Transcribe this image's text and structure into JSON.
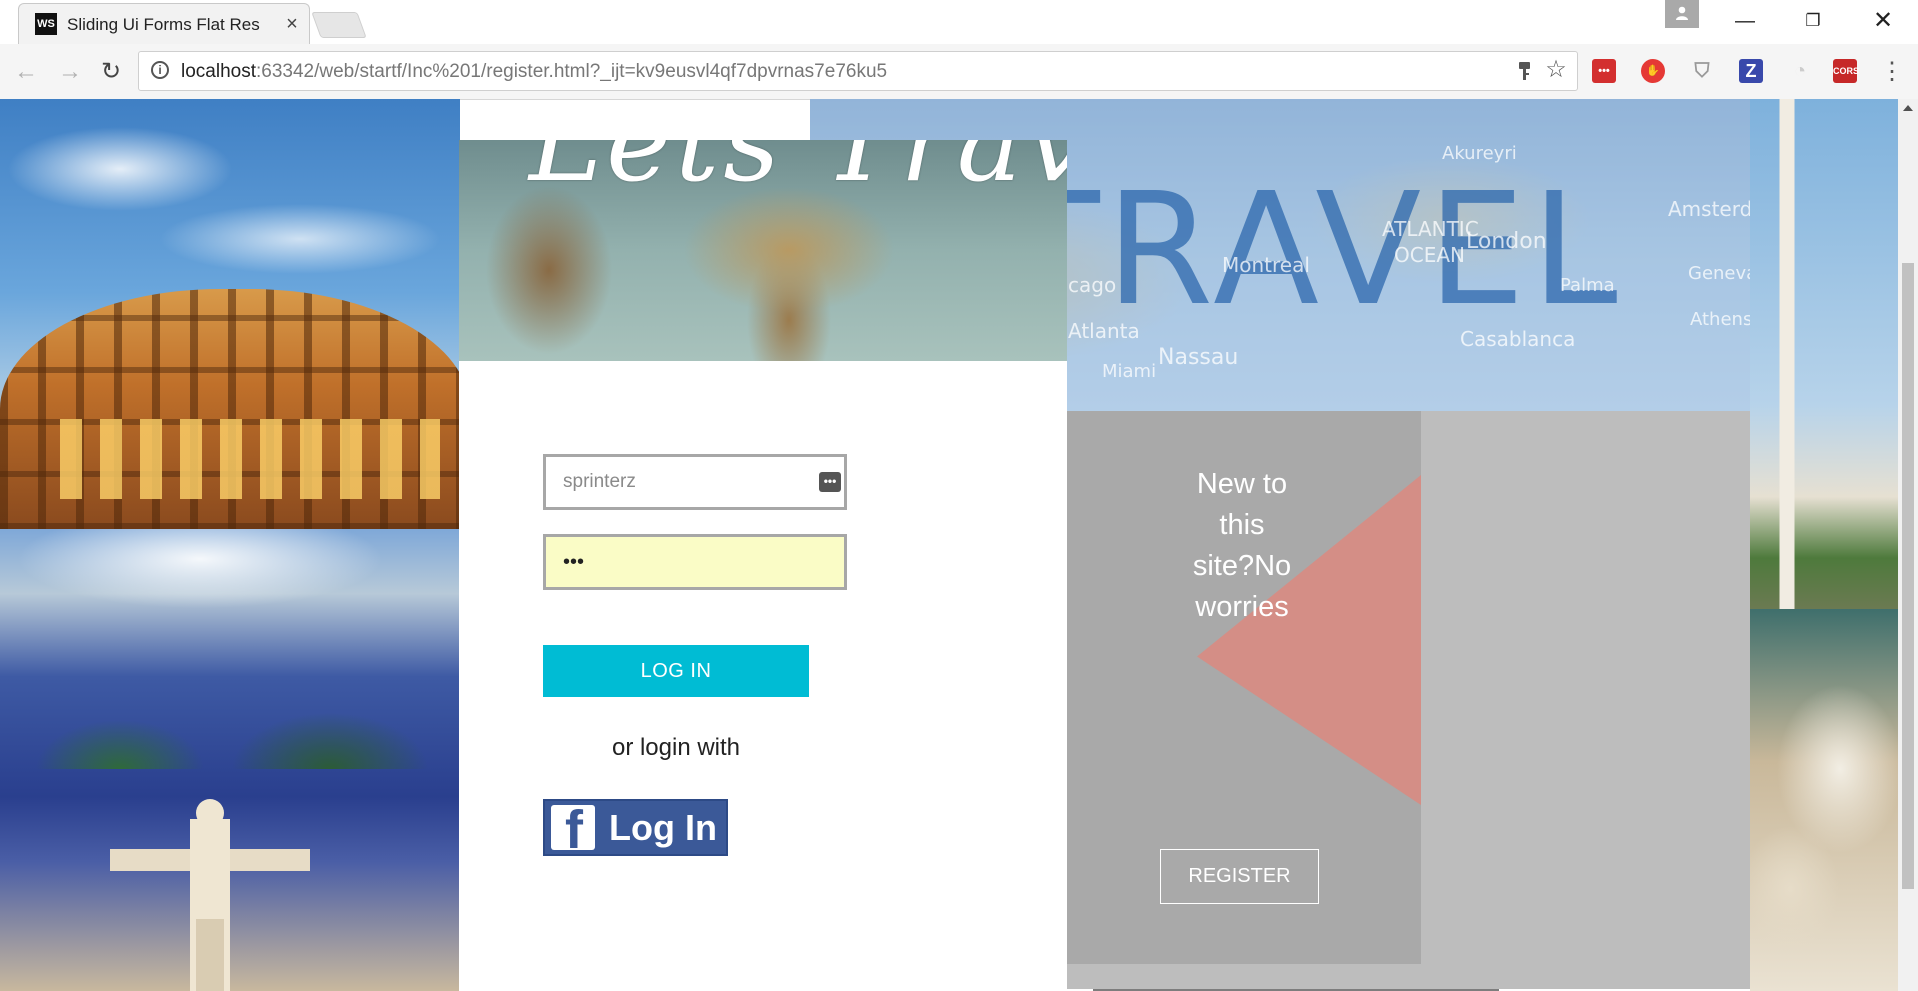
{
  "browser": {
    "tab": {
      "favicon_text": "WS",
      "title": "Sliding Ui Forms Flat Res"
    },
    "url": {
      "host": "localhost",
      "rest": ":63342/web/startf/Inc%201/register.html?_ijt=kv9eusvl4qf7dpvrnas7e76ku5"
    },
    "extensions": [
      {
        "name": "lastpass-icon",
        "text": "•••",
        "color": "#d32f2f"
      },
      {
        "name": "adblock-icon",
        "text": "✋",
        "color": "#e53935"
      },
      {
        "name": "shield-icon",
        "text": "",
        "color": "#9e9e9e"
      },
      {
        "name": "zotero-icon",
        "text": "Z",
        "color": "#3949ab"
      },
      {
        "name": "extension-grey-icon",
        "text": "",
        "color": "#cfcfcf"
      },
      {
        "name": "cors-icon",
        "text": "CORS",
        "color": "#c62828"
      }
    ]
  },
  "page": {
    "hero_word": "TRAVEL",
    "map_labels": [
      "Akureyri",
      "ATLANTIC",
      "OCEAN",
      "London",
      "Amsterd",
      "Montreal",
      "Palma",
      "Geneva",
      "Athens",
      "cago",
      "Atlanta",
      "Nassau",
      "Casablanca",
      "Miami"
    ],
    "card_title": "Lets Travel",
    "login": {
      "username_value": "sprinterz",
      "password_value": "•••",
      "login_button": "LOG IN",
      "or_text": "or login with",
      "facebook_button": "Log In",
      "facebook_letter": "f"
    },
    "register": {
      "message_lines": [
        "New to",
        "this",
        "site?No",
        "worries"
      ],
      "button": "REGISTER"
    },
    "colors": {
      "accent": "#00bcd4",
      "facebook": "#3b5998",
      "register_panel": "#bdbdbd",
      "triangle": "#d48e86",
      "autofill": "#fafcc6"
    }
  }
}
